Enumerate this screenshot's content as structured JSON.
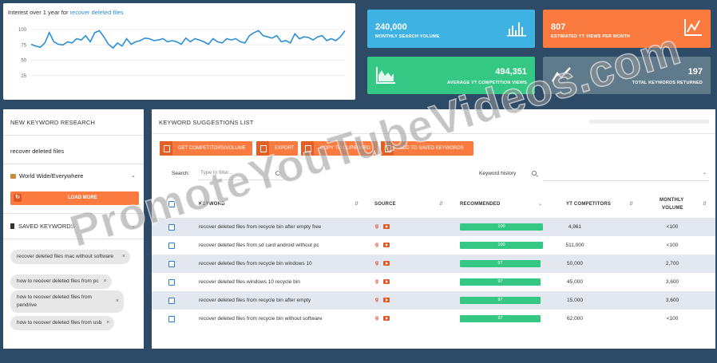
{
  "interest": {
    "title_prefix": "Interest over 1 year for",
    "title_link": "recover deleted files",
    "y_ticks": [
      "100",
      "75",
      "50",
      "25"
    ],
    "series": [
      76,
      73,
      71,
      78,
      95,
      80,
      76,
      75,
      80,
      78,
      85,
      83,
      90,
      80,
      95,
      98,
      88,
      76,
      70,
      78,
      73,
      85,
      76,
      80,
      82,
      86,
      85,
      82,
      83,
      85,
      80,
      82,
      80,
      76,
      86,
      80,
      85,
      83,
      80,
      76,
      85,
      80,
      78,
      85,
      83,
      85,
      80,
      78,
      90,
      95,
      98,
      90,
      88,
      86,
      90,
      80,
      82,
      78,
      93,
      85,
      88,
      87,
      83,
      88,
      90,
      82,
      85,
      82,
      88,
      98
    ]
  },
  "stats": [
    {
      "value": "240,000",
      "label": "MONTHLY SEARCH VOLUME",
      "color": "#3fb2e4",
      "icon": "bar-chart-icon"
    },
    {
      "value": "807",
      "label": "ESTIMATED YT VIEWS PER MONTH",
      "color": "#fb7a3f",
      "icon": "line-chart-icon"
    },
    {
      "value": "494,351",
      "label": "AVERAGE YT COMPETITION VIEWS",
      "color": "#34c884",
      "icon": "area-chart-icon"
    },
    {
      "value": "197",
      "label": "TOTAL KEYWORDS RETURNED",
      "color": "#5f7a8a",
      "icon": "trend-line-icon"
    }
  ],
  "left": {
    "title": "NEW KEYWORD RESEARCH",
    "query": "recover deleted files",
    "location": "World Wide/Everywhere",
    "load_more": "LOAD MORE",
    "saved_title": "SAVED KEYWORDS",
    "saved": [
      "recover deleted files mac without software",
      "how to recover deleted files from pc",
      "how to recover deleted files from pendrive",
      "how to recover deleted files from usb"
    ]
  },
  "main": {
    "title": "KEYWORD SUGGESTIONS LIST",
    "buttons": [
      "GET COMPETITORS/VOLUME",
      "EXPORT",
      "COPY TO CLIPBOARD",
      "ADD TO SAVED KEYWORDS"
    ],
    "search_label": "Search:",
    "filter_placeholder": "Type to filter...",
    "history_label": "Keyword history",
    "columns": {
      "keyword": "KEYWORD",
      "source": "SOURCE",
      "recommended": "RECOMMENDED",
      "competitors": "YT COMPETITORS",
      "volume_1": "MONTHLY",
      "volume_2": "VOLUME"
    },
    "rows": [
      {
        "keyword": "recover deleted files from recycle bin after empty free",
        "score": 100,
        "competitors": "4,961",
        "volume": "<100"
      },
      {
        "keyword": "recover deleted files from sd card android without pc",
        "score": 100,
        "competitors": "511,000",
        "volume": "<100"
      },
      {
        "keyword": "recover deleted files from recycle bin windows 10",
        "score": 97,
        "competitors": "50,000",
        "volume": "2,700"
      },
      {
        "keyword": "recover deleted files windows 10 recycle bin",
        "score": 97,
        "competitors": "45,000",
        "volume": "3,600"
      },
      {
        "keyword": "recover deleted files from recycle bin after empty",
        "score": 97,
        "competitors": "15,000",
        "volume": "3,600"
      },
      {
        "keyword": "recover deleted files from recycle bin without software",
        "score": 97,
        "competitors": "62,000",
        "volume": "<100"
      }
    ]
  },
  "watermark": "PromoteYouTubeVideos.com"
}
